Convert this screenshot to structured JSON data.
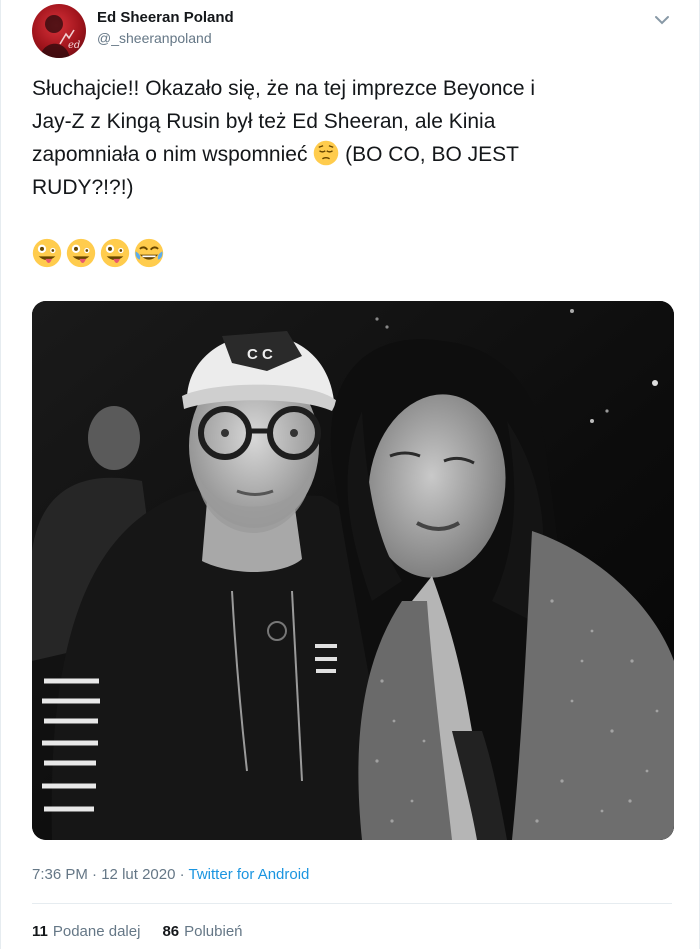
{
  "user": {
    "display_name": "Ed Sheeran Poland",
    "handle": "@_sheeranpoland"
  },
  "tweet": {
    "text_part1": "Słuchajcie!! Okazało się, że na tej imprezce Beyonce i\nJay-Z z Kingą Rusin był też Ed Sheeran, ale Kinia\nzapomniała o nim wspomnieć ",
    "text_part2": " (BO CO, BO JEST\nRUDY?!?!)",
    "inline_emoji": "pensive-face-emoji",
    "emoji_row": [
      "zany-face-emoji",
      "zany-face-emoji",
      "zany-face-emoji",
      "face-with-tears-of-joy-emoji"
    ]
  },
  "meta": {
    "time": "7:36 PM",
    "separator": " · ",
    "date": "12 lut 2020",
    "source": "Twitter for Android"
  },
  "stats": {
    "retweets_count": "11",
    "retweets_label": "Podane dalej",
    "likes_count": "86",
    "likes_label": "Polubień"
  },
  "photo": {
    "cap_logo_text": "C C",
    "description_icon": "photo-image"
  },
  "colors": {
    "text": "#14171a",
    "secondary": "#657786",
    "link": "#1b95e0",
    "border": "#e6ecf0",
    "avatar_bg": "#a0141c"
  }
}
